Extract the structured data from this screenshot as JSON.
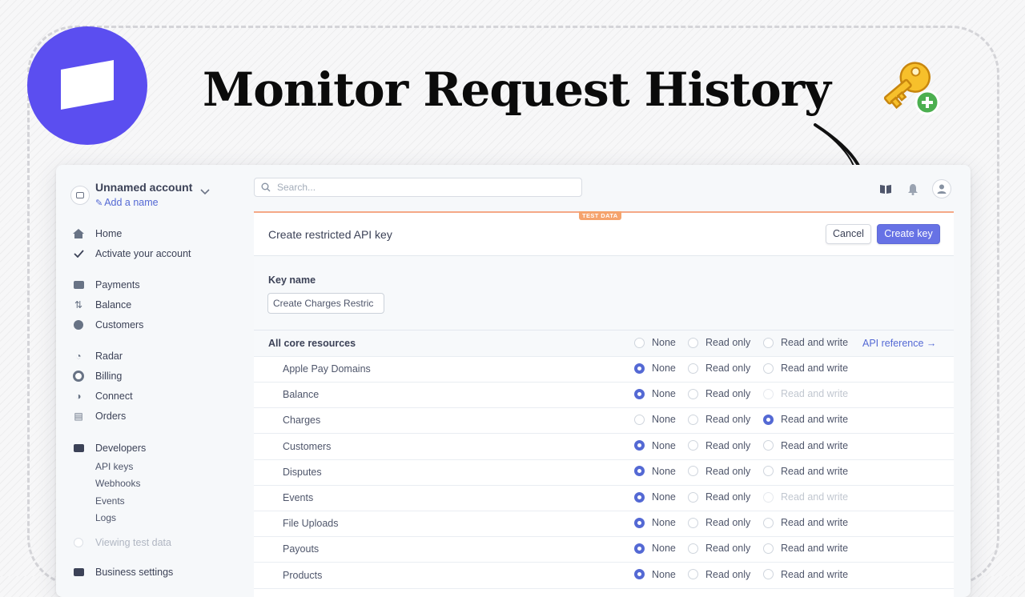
{
  "headline": "Monitor Request History",
  "colors": {
    "brand_purple": "#5b4ef0",
    "accent_button": "#6772e5",
    "radio_selected": "#5469d4",
    "test_badge": "#f5a36c"
  },
  "account": {
    "name": "Unnamed account",
    "add_name": "Add a name"
  },
  "nav": {
    "home": "Home",
    "activate": "Activate your account",
    "payments": "Payments",
    "balance": "Balance",
    "customers": "Customers",
    "radar": "Radar",
    "billing": "Billing",
    "connect": "Connect",
    "orders": "Orders",
    "developers": "Developers",
    "api_keys": "API keys",
    "webhooks": "Webhooks",
    "events": "Events",
    "logs": "Logs",
    "viewing_test": "Viewing test data",
    "business_settings": "Business settings"
  },
  "search": {
    "placeholder": "Search..."
  },
  "panel": {
    "test_badge": "TEST DATA",
    "title": "Create restricted API key",
    "cancel": "Cancel",
    "create": "Create key",
    "key_name_label": "Key name",
    "key_name_value": "Create Charges Restric"
  },
  "options": {
    "none": "None",
    "read": "Read only",
    "write": "Read and write"
  },
  "api_reference": "API reference →",
  "all_core": "All core resources",
  "resources": [
    {
      "name": "Apple Pay Domains",
      "selected": "none",
      "write_disabled": false
    },
    {
      "name": "Balance",
      "selected": "none",
      "write_disabled": true
    },
    {
      "name": "Charges",
      "selected": "write",
      "write_disabled": false
    },
    {
      "name": "Customers",
      "selected": "none",
      "write_disabled": false
    },
    {
      "name": "Disputes",
      "selected": "none",
      "write_disabled": false
    },
    {
      "name": "Events",
      "selected": "none",
      "write_disabled": true
    },
    {
      "name": "File Uploads",
      "selected": "none",
      "write_disabled": false
    },
    {
      "name": "Payouts",
      "selected": "none",
      "write_disabled": false
    },
    {
      "name": "Products",
      "selected": "none",
      "write_disabled": false
    }
  ]
}
